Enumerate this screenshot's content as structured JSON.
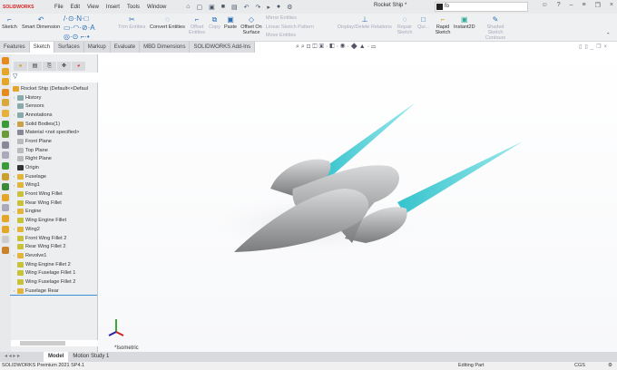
{
  "app": {
    "logo": "SOLIDWORKS",
    "document_title": "Rocket Ship *",
    "search_value": "fo"
  },
  "menu": [
    "File",
    "Edit",
    "View",
    "Insert",
    "Tools",
    "Window"
  ],
  "ribbon": {
    "buttons": [
      {
        "label": "Sketch",
        "enabled": true
      },
      {
        "label": "Smart Dimension",
        "enabled": true
      },
      {
        "label": "Trim Entities",
        "enabled": false
      },
      {
        "label": "Convert Entities",
        "enabled": true
      },
      {
        "label": "Offset Entities",
        "enabled": false
      },
      {
        "label": "Copy",
        "enabled": false
      },
      {
        "label": "Paste",
        "enabled": true
      },
      {
        "label": "Offset On Surface",
        "enabled": true
      },
      {
        "label": "Mirror Entities",
        "enabled": false
      },
      {
        "label": "Linear Sketch Pattern",
        "enabled": false
      },
      {
        "label": "Move Entities",
        "enabled": false
      },
      {
        "label": "Display/Delete Relations",
        "enabled": false
      },
      {
        "label": "Repair Sketch",
        "enabled": false
      },
      {
        "label": "Qui...",
        "enabled": false
      },
      {
        "label": "Rapid Sketch",
        "enabled": true
      },
      {
        "label": "Instant2D",
        "enabled": true
      },
      {
        "label": "Shaded Sketch Contours",
        "enabled": false
      }
    ]
  },
  "tabs": [
    "Features",
    "Sketch",
    "Surfaces",
    "Markup",
    "Evaluate",
    "MBD Dimensions",
    "SOLIDWORKS Add-Ins"
  ],
  "active_tab": "Sketch",
  "tree": {
    "root": "Rocket Ship  (Default<<Defaul",
    "items": [
      {
        "label": "History",
        "expand": true,
        "color": "#8aa"
      },
      {
        "label": "Sensors",
        "expand": false,
        "color": "#8aa"
      },
      {
        "label": "Annotations",
        "expand": true,
        "color": "#8aa"
      },
      {
        "label": "Solid Bodies(1)",
        "expand": true,
        "color": "#c9a24a"
      },
      {
        "label": "Material <not specified>",
        "expand": false,
        "color": "#889"
      },
      {
        "label": "Front Plane",
        "expand": false,
        "color": "#bbb"
      },
      {
        "label": "Top Plane",
        "expand": false,
        "color": "#bbb"
      },
      {
        "label": "Right Plane",
        "expand": false,
        "color": "#bbb"
      },
      {
        "label": "Origin",
        "expand": false,
        "color": "#333"
      },
      {
        "label": "Fuselage",
        "expand": true,
        "color": "#e2b43a"
      },
      {
        "label": "Wing1",
        "expand": true,
        "color": "#e2b43a"
      },
      {
        "label": "Front Wing Fillet",
        "expand": false,
        "color": "#c8c23a"
      },
      {
        "label": "Rear Wing Fillet",
        "expand": false,
        "color": "#c8c23a"
      },
      {
        "label": "Engine",
        "expand": true,
        "color": "#e2b43a"
      },
      {
        "label": "Wing Engine Fillet",
        "expand": false,
        "color": "#c8c23a"
      },
      {
        "label": "Wing2",
        "expand": true,
        "color": "#e2b43a"
      },
      {
        "label": "Front Wing Fillet 2",
        "expand": false,
        "color": "#c8c23a"
      },
      {
        "label": "Rear Wing Fillet 2",
        "expand": false,
        "color": "#c8c23a"
      },
      {
        "label": "Revolve1",
        "expand": true,
        "color": "#e2b43a"
      },
      {
        "label": "Wing Engine Fillet 2",
        "expand": false,
        "color": "#c8c23a"
      },
      {
        "label": "Wing Fuselage Fillet 1",
        "expand": false,
        "color": "#c8c23a"
      },
      {
        "label": "Wing Fuselage Fillet 2",
        "expand": false,
        "color": "#c8c23a"
      },
      {
        "label": "Fuselage Rear",
        "expand": true,
        "color": "#e2b43a"
      }
    ]
  },
  "viewport": {
    "view_label": "*Isometric"
  },
  "bottom_tabs": [
    "Model",
    "Motion Study 1"
  ],
  "active_bottom_tab": "Model",
  "status": {
    "version": "SOLIDWORKS Premium 2021 SP4.1",
    "mode": "Editing Part",
    "units": "CGS"
  },
  "colors": {
    "accent": "#3b8fd6",
    "brand": "#d22222",
    "thruster": "#3cc8d0",
    "body": "#a8a9ab"
  }
}
